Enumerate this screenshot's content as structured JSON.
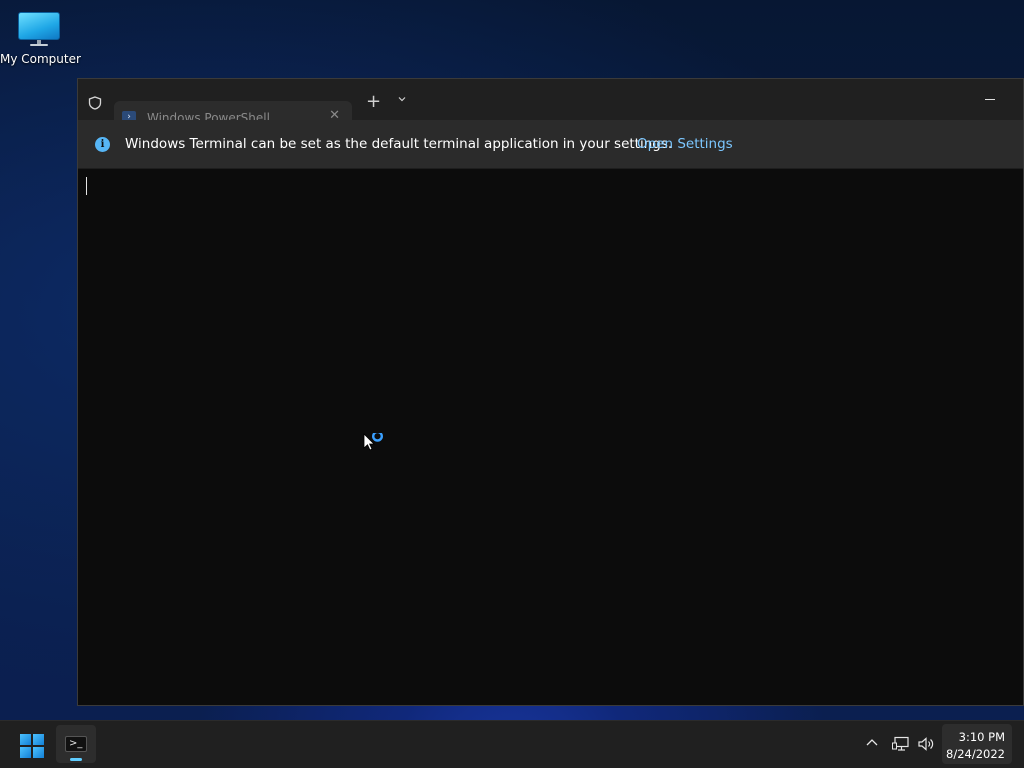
{
  "desktop": {
    "icons": [
      {
        "label": "My Computer",
        "icon": "monitor-icon"
      }
    ]
  },
  "window": {
    "app": "Windows Terminal",
    "tab": {
      "title": "Windows PowerShell",
      "icon": "powershell-icon",
      "close_glyph": "✕"
    },
    "new_tab_glyph": "+",
    "infobar": {
      "icon": "info-icon",
      "message": "Windows Terminal can be set as the default terminal application in your settings.",
      "link": "Open Settings"
    },
    "colors": {
      "background": "#0c0c0c",
      "titlebar": "#202020",
      "infobar": "#2b2b2b",
      "link": "#7cc7ff"
    }
  },
  "taskbar": {
    "start_icon": "windows-logo-icon",
    "apps": [
      {
        "name": "Windows Terminal",
        "icon": "terminal-icon",
        "glyph": ">_",
        "active": true
      }
    ],
    "tray": {
      "icons": [
        "chevron-up-icon",
        "network-icon",
        "volume-icon"
      ]
    },
    "clock": {
      "time": "3:10 PM",
      "date": "8/24/2022"
    }
  }
}
